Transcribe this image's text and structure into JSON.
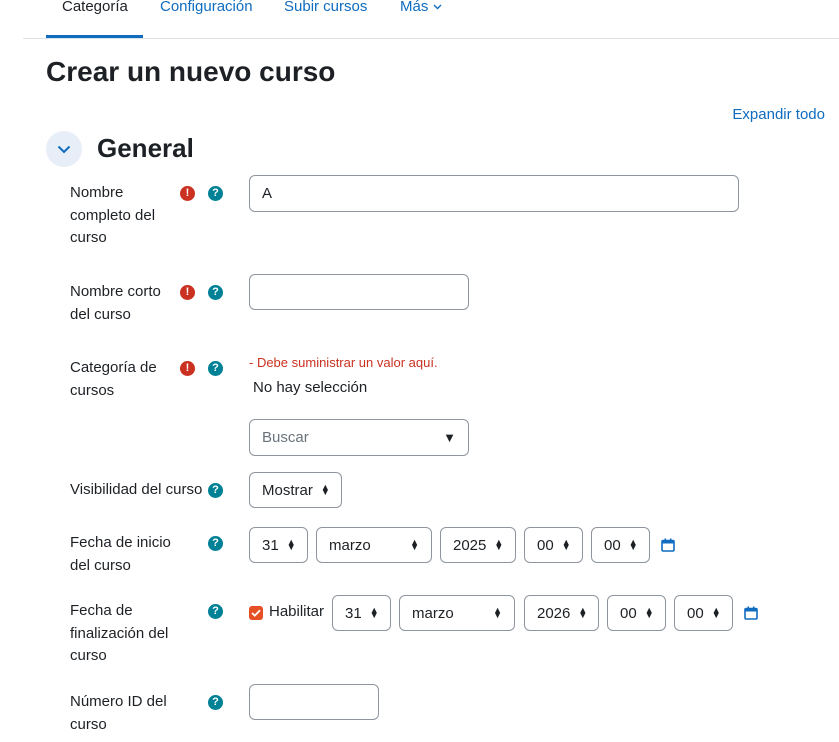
{
  "tabs": [
    {
      "label": "Categoría",
      "active": true
    },
    {
      "label": "Configuración",
      "active": false
    },
    {
      "label": "Subir cursos",
      "active": false
    },
    {
      "label": "Más",
      "active": false
    }
  ],
  "page_title": "Crear un nuevo curso",
  "expand_all": "Expandir todo",
  "section": {
    "title": "General"
  },
  "fields": {
    "fullname": {
      "label": "Nombre completo del curso",
      "value": "A"
    },
    "shortname": {
      "label": "Nombre corto del curso",
      "value": ""
    },
    "category": {
      "label": "Categoría de cursos",
      "error": "- Debe suministrar un valor aquí.",
      "selection": "No hay selección",
      "search_placeholder": "Buscar",
      "dropdown_arrow": "▼"
    },
    "visibility": {
      "label": "Visibilidad del curso",
      "value": "Mostrar"
    },
    "startdate": {
      "label": "Fecha de inicio del curso",
      "day": "31",
      "month": "marzo",
      "year": "2025",
      "hour": "00",
      "minute": "00"
    },
    "enddate": {
      "label": "Fecha de finalización del curso",
      "enable_label": "Habilitar",
      "enabled": true,
      "day": "31",
      "month": "marzo",
      "year": "2026",
      "hour": "00",
      "minute": "00"
    },
    "idnumber": {
      "label": "Número ID del curso",
      "value": ""
    }
  },
  "icons": {
    "required": "exclamation-circle-icon",
    "help": "question-circle-icon",
    "calendar": "calendar-icon",
    "collapse": "chevron-down-icon"
  },
  "colors": {
    "link": "#0f6cbf",
    "required": "#ca3120",
    "help": "#008196",
    "checkbox": "#e55025"
  }
}
